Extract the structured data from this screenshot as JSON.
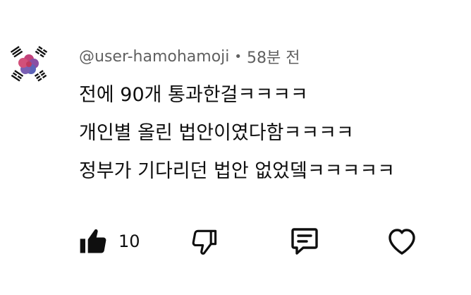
{
  "comment": {
    "author": "@user-hamohamoji",
    "separator": "•",
    "time": "58분 전",
    "lines": [
      "전에 90개 통과한걸ㅋㅋㅋㅋ",
      "개인별 올린 법안이였다함ㅋㅋㅋㅋ",
      "정부가 기다리던 법안 없었뎈ㅋㅋㅋㅋㅋ"
    ]
  },
  "actions": {
    "like_icon": "thumbs-up-filled-icon",
    "like_count": "10",
    "dislike_icon": "thumbs-down-outline-icon",
    "reply_icon": "comment-bubble-icon",
    "heart_icon": "heart-outline-icon"
  },
  "colors": {
    "text": "#0f0f0f",
    "meta": "#606060"
  }
}
